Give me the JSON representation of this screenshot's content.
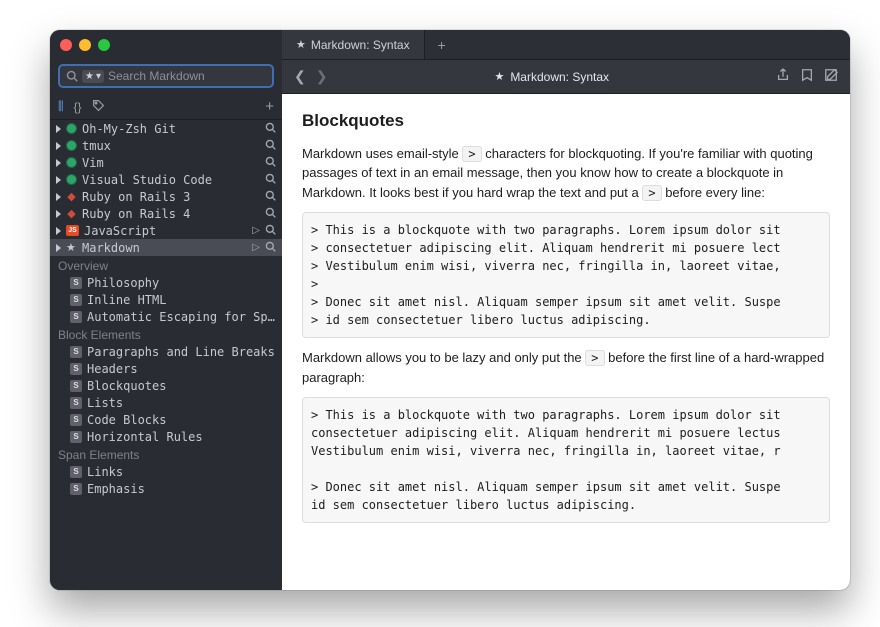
{
  "search": {
    "placeholder": "Search Markdown"
  },
  "sidebar": {
    "top": [
      {
        "icon": "dot",
        "label": "Oh-My-Zsh Git"
      },
      {
        "icon": "dot",
        "label": "tmux"
      },
      {
        "icon": "dot",
        "label": "Vim"
      },
      {
        "icon": "dot",
        "label": "Visual Studio Code"
      },
      {
        "icon": "ruby",
        "label": "Ruby on Rails 3"
      },
      {
        "icon": "ruby",
        "label": "Ruby on Rails 4"
      },
      {
        "icon": "js",
        "label": "JavaScript",
        "play": true
      },
      {
        "icon": "star",
        "label": "Markdown",
        "play": true,
        "sel": true
      }
    ],
    "sections": [
      {
        "title": "Overview",
        "items": [
          "Philosophy",
          "Inline HTML",
          "Automatic Escaping for Specia…"
        ]
      },
      {
        "title": "Block Elements",
        "items": [
          "Paragraphs and Line Breaks",
          "Headers",
          "Blockquotes",
          "Lists",
          "Code Blocks",
          "Horizontal Rules"
        ]
      },
      {
        "title": "Span Elements",
        "items": [
          "Links",
          "Emphasis"
        ]
      }
    ]
  },
  "tab": {
    "label": "Markdown: Syntax"
  },
  "toolbar": {
    "title": "Markdown: Syntax"
  },
  "doc": {
    "heading": "Blockquotes",
    "p1a": "Markdown uses email-style ",
    "p1b": " characters for blockquoting. If you're familiar with quoting passages of text in an email message, then you know how to create a blockquote in Markdown. It looks best if you hard wrap the text and put a ",
    "p1c": " before every line:",
    "gt": ">",
    "code1": "> This is a blockquote with two paragraphs. Lorem ipsum dolor sit\n> consectetuer adipiscing elit. Aliquam hendrerit mi posuere lect\n> Vestibulum enim wisi, viverra nec, fringilla in, laoreet vitae,\n>\n> Donec sit amet nisl. Aliquam semper ipsum sit amet velit. Suspe\n> id sem consectetuer libero luctus adipiscing.",
    "p2a": "Markdown allows you to be lazy and only put the ",
    "p2b": " before the first line of a hard-wrapped paragraph:",
    "code2": "> This is a blockquote with two paragraphs. Lorem ipsum dolor sit\nconsectetuer adipiscing elit. Aliquam hendrerit mi posuere lectus\nVestibulum enim wisi, viverra nec, fringilla in, laoreet vitae, r\n\n> Donec sit amet nisl. Aliquam semper ipsum sit amet velit. Suspe\nid sem consectetuer libero luctus adipiscing."
  }
}
